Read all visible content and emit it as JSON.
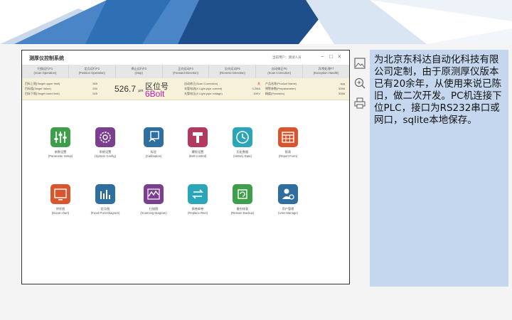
{
  "app": {
    "title": "测厚仪控制系统",
    "user_label": "当前用户：测试人员",
    "window_minimize": "−",
    "window_maximize": "□",
    "window_close": "×"
  },
  "menu": [
    {
      "cn": "扫描运行F1",
      "en": "(Scan Operation)"
    },
    {
      "cn": "定点运行F2",
      "en": "(Position Operation)"
    },
    {
      "cn": "停止运行F3",
      "en": "(Stop)"
    },
    {
      "cn": "正向运动F4",
      "en": "(Forward Direction)"
    },
    {
      "cn": "反向运动F5",
      "en": "(Reverse Direction)"
    },
    {
      "cn": "自动修正F6",
      "en": "(Scan Correction)"
    },
    {
      "cn": "异常处理F7",
      "en": "(Exception Handle)"
    }
  ],
  "status": {
    "upper_label": "目标上限(Target upper limit)",
    "upper_value": "565",
    "target_label": "目标值(Target Value)",
    "target_value": "530",
    "lower_label": "目标下限(Target lower limit)",
    "lower_value": "525",
    "reading_value": "526.7",
    "reading_unit": "μm",
    "zone_label": "区位号",
    "bolt_label": "6Bolt",
    "scan_correction_label": "自动修正(Scan Correction)",
    "scan_correction_value": "关",
    "light_current_label": "光管电流(X Light pipe current)",
    "light_current_value": "0.2MA",
    "light_voltage_label": "光管电压(X Light pipe voltage)",
    "light_voltage_value": "19KV",
    "product_label": "产品名称(Product Name)",
    "product_value": "qqq",
    "prep_label": "预警参数(Preparameter)",
    "prep_value": "5068",
    "precision_label": "精度(Precision)",
    "precision_value": "5068"
  },
  "tiles": [
    {
      "cn": "参数设置",
      "en": "(Parameter Setup)",
      "icon": "sliders-icon",
      "color": "#3f9e4c"
    },
    {
      "cn": "系统设置",
      "en": "(System Config)",
      "icon": "gear-icon",
      "color": "#7a3f8f"
    },
    {
      "cn": "标定",
      "en": "(Calibration)",
      "icon": "calibration-icon",
      "color": "#2f6f9f"
    },
    {
      "cn": "螺栓设置",
      "en": "(Bolt Control)",
      "icon": "bolt-icon",
      "color": "#b23a5e"
    },
    {
      "cn": "历史数据",
      "en": "(History Data)",
      "icon": "history-icon",
      "color": "#2aa6b8"
    },
    {
      "cn": "报表",
      "en": "(Report Form)",
      "icon": "table-icon",
      "color": "#d8552e"
    },
    {
      "cn": "饼状图",
      "en": "(Donut chart)",
      "icon": "monitor-icon",
      "color": "#d8552e"
    },
    {
      "cn": "定点图",
      "en": "(Fixed Point Diagram)",
      "icon": "bar-chart-icon",
      "color": "#2f6f9f"
    },
    {
      "cn": "扫描图",
      "en": "(Scanning Diagram)",
      "icon": "wave-chart-icon",
      "color": "#7a3f8f"
    },
    {
      "cn": "换卷卸卷",
      "en": "(Replace Reel)",
      "icon": "swap-icon",
      "color": "#2aa6b8"
    },
    {
      "cn": "备份恢复",
      "en": "(Restore Backup)",
      "icon": "restore-icon",
      "color": "#3f9e4c"
    },
    {
      "cn": "用户管理",
      "en": "(User Manage)",
      "icon": "user-gear-icon",
      "color": "#2f6f9f"
    }
  ],
  "side_tools": [
    "image-icon",
    "zoom-in-icon",
    "print-icon"
  ],
  "note": {
    "text": "为北京东科达自动化科技有限公司定制，由于原测厚仪版本已有20余年，从使用来说已陈旧，做二次开发。PC机连接下位PLC，接口为RS232串口或网口，sqlite本地保存。"
  }
}
